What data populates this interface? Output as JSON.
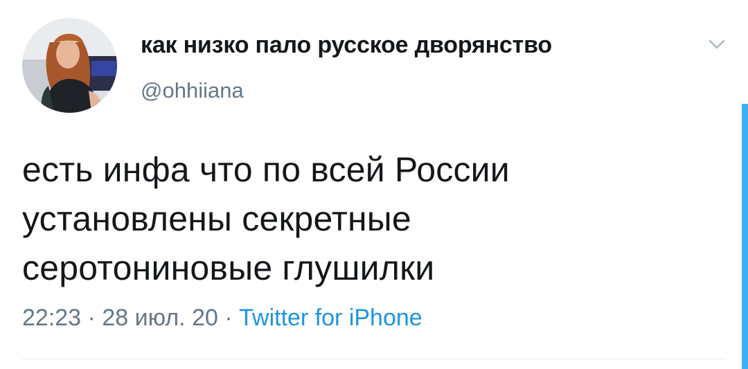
{
  "tweet": {
    "display_name": "как низко пало русское дворянство",
    "handle": "@ohhiiana",
    "text_lines": [
      "есть инфа что по всей России",
      "установлены секретные",
      "серотониновые глушилки"
    ],
    "time": "22:23",
    "date": "28 июл. 20",
    "separator": "·",
    "source": "Twitter for iPhone"
  },
  "icons": {
    "caret": "chevron-down-icon"
  },
  "colors": {
    "text": "#14171a",
    "secondary": "#657786",
    "link": "#1b95e0",
    "accent": "#1da1f2"
  }
}
